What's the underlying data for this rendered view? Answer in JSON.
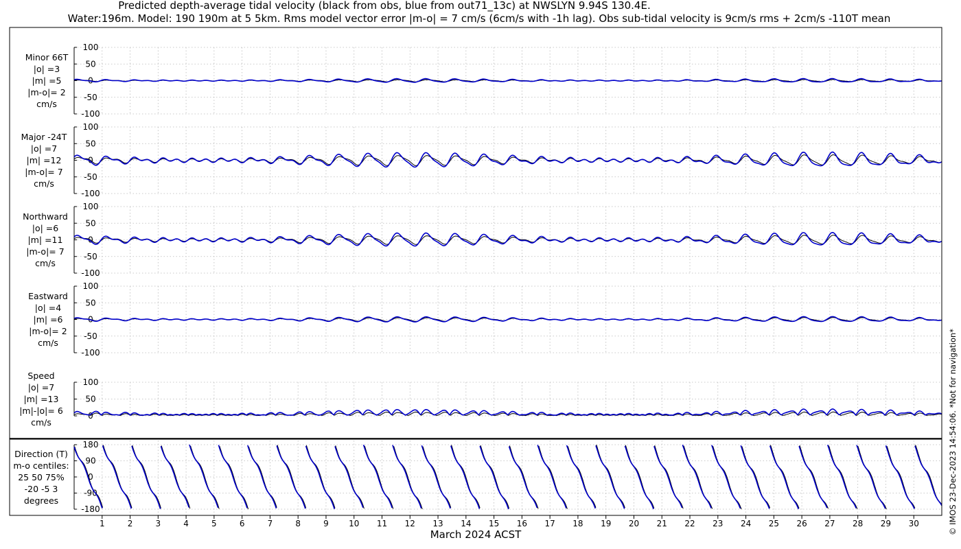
{
  "title_line1": "Predicted depth-average tidal velocity (black from obs, blue from out71_13c) at NWSLYN 9.94S 130.4E.",
  "title_line2": "Water:196m. Model: 190 190m at 5 5km. Rms model vector error |m-o| = 7 cm/s (6cm/s with -1h lag). Obs sub-tidal velocity is 9cm/s rms + 2cm/s -110T mean",
  "copyright": "© IMOS 23-Dec-2023 14:54:06. *Not for navigation*",
  "colors": {
    "obs": "#000000",
    "model": "#0000cc",
    "axis": "#000000",
    "grid": "#b8b8b8"
  },
  "chart_data": {
    "type": "line",
    "xlabel": "March 2024 ACST",
    "xlim": [
      0,
      31
    ],
    "xticks": [
      1,
      2,
      3,
      4,
      5,
      6,
      7,
      8,
      9,
      10,
      11,
      12,
      13,
      14,
      15,
      16,
      17,
      18,
      19,
      20,
      21,
      22,
      23,
      24,
      25,
      26,
      27,
      28,
      29,
      30
    ],
    "grid": true,
    "series_legend": [
      {
        "name": "obs",
        "color": "#000000"
      },
      {
        "name": "out71_13c",
        "color": "#0000cc"
      }
    ],
    "panels": [
      {
        "id": "minor",
        "label": [
          "Minor 66T",
          "|o| =3",
          "|m| =5",
          "|m-o|= 2",
          "cm/s"
        ],
        "ylim": [
          -100,
          100
        ],
        "yticks": [
          100,
          50,
          0,
          -50,
          -100
        ],
        "kind": "velocity",
        "obs_amp": 3,
        "model_amp": 5,
        "phase_lag": 0.5,
        "samples_x_step_days": 0.04
      },
      {
        "id": "major",
        "label": [
          "Major -24T",
          "|o| =7",
          "|m| =12",
          "|m-o|= 7",
          "cm/s"
        ],
        "ylim": [
          -100,
          100
        ],
        "yticks": [
          100,
          50,
          0,
          -50,
          -100
        ],
        "kind": "velocity",
        "obs_amp": 14,
        "model_amp": 20,
        "phase_lag": 0.35,
        "samples_x_step_days": 0.04
      },
      {
        "id": "northward",
        "label": [
          "Northward",
          "|o| =6",
          "|m| =11",
          "|m-o|= 7",
          "cm/s"
        ],
        "ylim": [
          -100,
          100
        ],
        "yticks": [
          100,
          50,
          0,
          -50,
          -100
        ],
        "kind": "velocity",
        "obs_amp": 12,
        "model_amp": 18,
        "phase_lag": 0.35,
        "samples_x_step_days": 0.04
      },
      {
        "id": "eastward",
        "label": [
          "Eastward",
          "|o| =4",
          "|m| =6",
          "|m-o|= 2",
          "cm/s"
        ],
        "ylim": [
          -100,
          100
        ],
        "yticks": [
          100,
          50,
          0,
          -50,
          -100
        ],
        "kind": "velocity",
        "obs_amp": 5,
        "model_amp": 7,
        "phase_lag": 0.3,
        "samples_x_step_days": 0.04
      },
      {
        "id": "speed",
        "label": [
          "Speed",
          "|o| =7",
          "|m| =13",
          "|m|-|o|= 6",
          "cm/s"
        ],
        "ylim": [
          0,
          100
        ],
        "yticks": [
          100,
          50,
          0
        ],
        "kind": "speed",
        "obs_amp": 9,
        "model_amp": 15,
        "phase_lag": 0.3,
        "samples_x_step_days": 0.04
      },
      {
        "id": "direction",
        "label": [
          "Direction (T)",
          "m-o centiles:",
          "25  50  75%",
          "-20  -5   3",
          "degrees"
        ],
        "ylim": [
          -180,
          180
        ],
        "yticks": [
          180,
          90,
          0,
          -90,
          -180
        ],
        "kind": "direction",
        "samples_x_step_days": 0.02
      }
    ]
  }
}
